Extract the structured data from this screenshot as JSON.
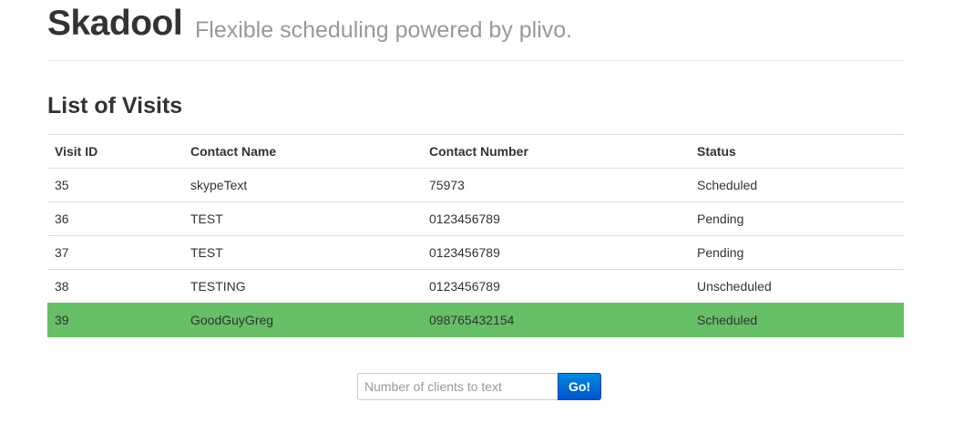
{
  "header": {
    "brand": "Skadool",
    "tagline": "Flexible scheduling powered by plivo."
  },
  "visits": {
    "title": "List of Visits",
    "columns": [
      "Visit ID",
      "Contact Name",
      "Contact Number",
      "Status"
    ],
    "rows": [
      {
        "id": "35",
        "name": "skypeText",
        "number": "75973",
        "status": "Scheduled"
      },
      {
        "id": "36",
        "name": "TEST",
        "number": "0123456789",
        "status": "Pending"
      },
      {
        "id": "37",
        "name": "TEST",
        "number": "0123456789",
        "status": "Pending"
      },
      {
        "id": "38",
        "name": "TESTING",
        "number": "0123456789",
        "status": "Unscheduled"
      },
      {
        "id": "39",
        "name": "GoodGuyGreg",
        "number": "098765432154",
        "status": "Scheduled"
      }
    ],
    "highlight_color": "#66bf66"
  },
  "form": {
    "input_placeholder": "Number of clients to text",
    "input_value": "",
    "submit_label": "Go!",
    "button_color": "#0066cc"
  }
}
